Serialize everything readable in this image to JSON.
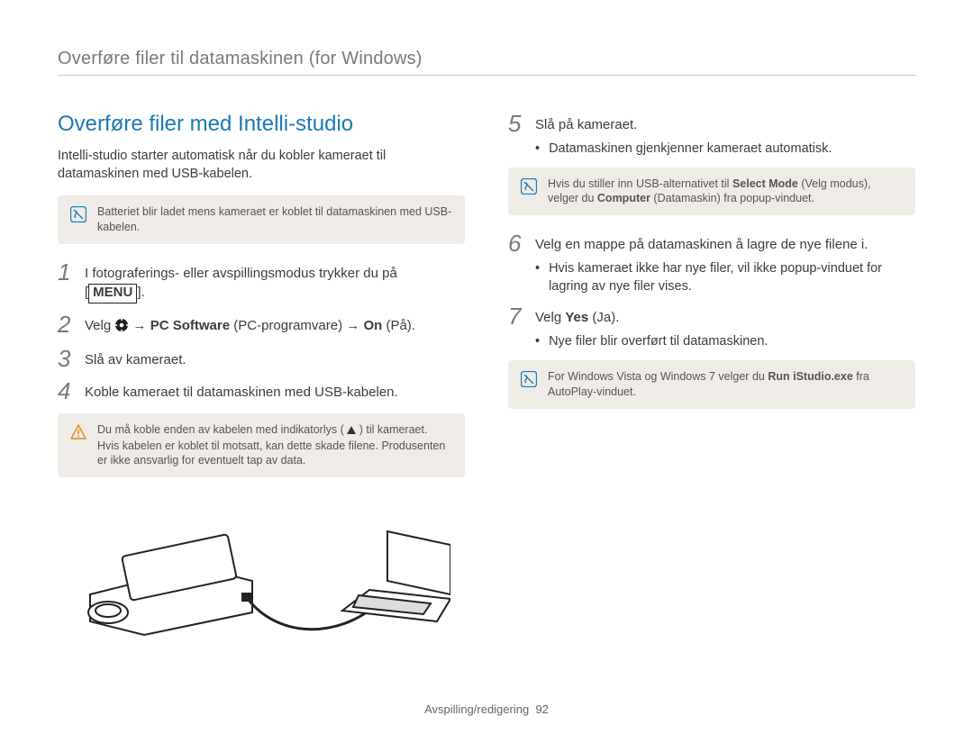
{
  "header": "Overføre filer til datamaskinen (for Windows)",
  "left": {
    "title": "Overføre filer med Intelli-studio",
    "intro": "Intelli-studio starter automatisk når du kobler kameraet til datamaskinen med USB-kabelen.",
    "note1": "Batteriet blir ladet mens kameraet er koblet til datamaskinen med USB-kabelen.",
    "step1": {
      "num": "1",
      "text_a": "I fotograferings- eller avspillingsmodus trykker du på ",
      "menu": "MENU",
      "text_b": "."
    },
    "step2": {
      "num": "2",
      "pre": "Velg ",
      "seg1_bold": "PC Software",
      "seg1_plain": " (PC-programvare) ",
      "seg2_bold": "On",
      "seg2_plain": " (På)."
    },
    "step3": {
      "num": "3",
      "text": "Slå av kameraet."
    },
    "step4": {
      "num": "4",
      "text": "Koble kameraet til datamaskinen med USB-kabelen."
    },
    "warn": {
      "a": "Du må koble enden av kabelen med indikatorlys (",
      "b": ") til kameraet. Hvis kabelen er koblet til motsatt, kan dette skade filene. Produsenten er ikke ansvarlig for eventuelt tap av data."
    }
  },
  "right": {
    "step5": {
      "num": "5",
      "text": "Slå på kameraet."
    },
    "step5_bullet": "Datamaskinen gjenkjenner kameraet automatisk.",
    "note2": {
      "a": "Hvis du stiller inn USB-alternativet til ",
      "b_bold": "Select Mode",
      "c": " (Velg modus), velger du ",
      "d_bold": "Computer",
      "e": " (Datamaskin) fra popup-vinduet."
    },
    "step6": {
      "num": "6",
      "text": "Velg en mappe på datamaskinen å lagre de nye filene i."
    },
    "step6_bullet": "Hvis kameraet ikke har nye filer, vil ikke popup-vinduet for lagring av nye filer vises.",
    "step7": {
      "num": "7",
      "pre": "Velg ",
      "yes_bold": "Yes",
      "post": " (Ja)."
    },
    "step7_bullet": "Nye filer blir overført til datamaskinen.",
    "note3": {
      "a": "For Windows Vista og Windows 7 velger du ",
      "b_bold": "Run iStudio.exe",
      "c": " fra AutoPlay-vinduet."
    }
  },
  "footer": {
    "section": "Avspilling/redigering",
    "page": "92"
  }
}
